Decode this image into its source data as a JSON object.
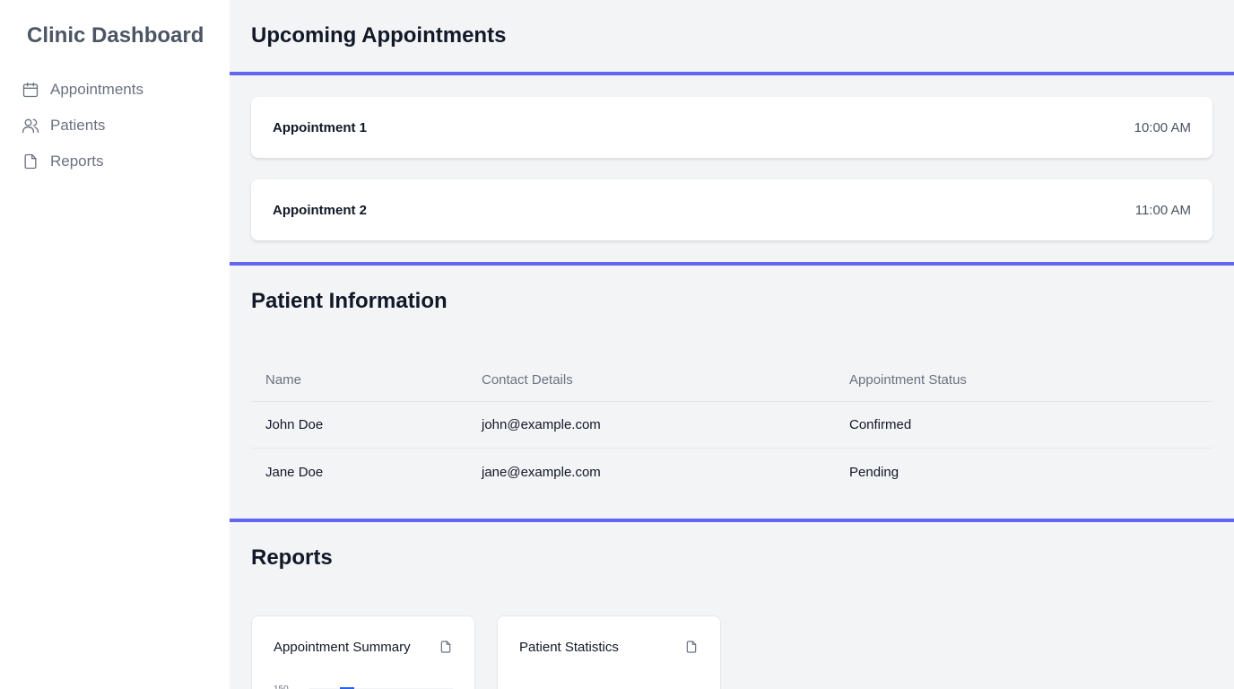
{
  "sidebar": {
    "brand": "Clinic Dashboard",
    "items": [
      {
        "label": "Appointments",
        "icon": "calendar-icon"
      },
      {
        "label": "Patients",
        "icon": "users-icon"
      },
      {
        "label": "Reports",
        "icon": "document-icon"
      }
    ]
  },
  "appointments": {
    "title": "Upcoming Appointments",
    "items": [
      {
        "name": "Appointment 1",
        "time": "10:00 AM"
      },
      {
        "name": "Appointment 2",
        "time": "11:00 AM"
      }
    ]
  },
  "patients": {
    "title": "Patient Information",
    "columns": [
      "Name",
      "Contact Details",
      "Appointment Status"
    ],
    "rows": [
      [
        "John Doe",
        "john@example.com",
        "Confirmed"
      ],
      [
        "Jane Doe",
        "jane@example.com",
        "Pending"
      ]
    ]
  },
  "reports": {
    "title": "Reports",
    "cards": [
      {
        "title": "Appointment Summary",
        "icon": "document-icon"
      },
      {
        "title": "Patient Statistics",
        "icon": "document-icon"
      }
    ]
  },
  "colors": {
    "accent": "#6366f1",
    "chart_bar": "#2563eb"
  },
  "chart_data": {
    "type": "bar",
    "title": "",
    "y_ticks": [
      "150"
    ],
    "values": [
      150
    ]
  }
}
